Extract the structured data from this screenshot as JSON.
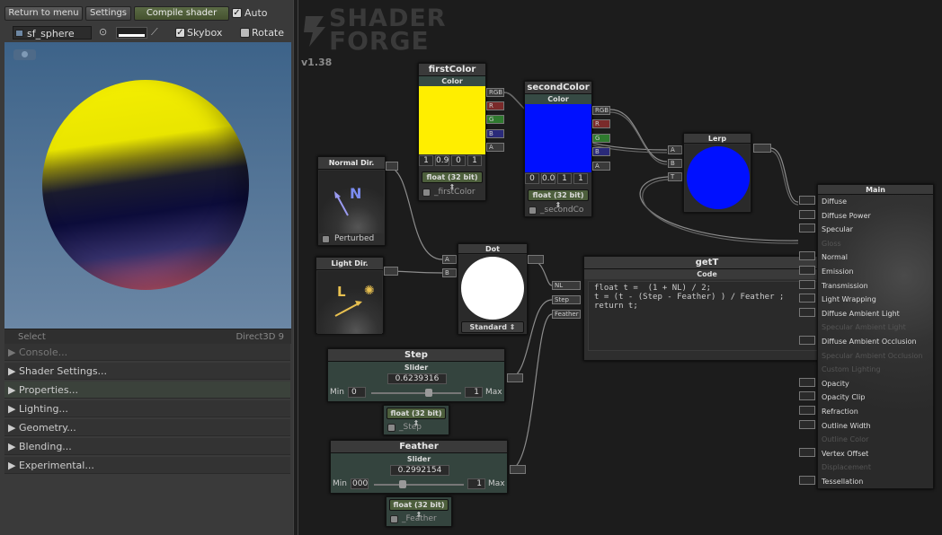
{
  "toolbar": {
    "return_label": "Return to menu",
    "settings_label": "Settings",
    "compile_label": "Compile shader",
    "auto_label": "Auto",
    "mesh_name": "sf_sphere",
    "skybox_label": "Skybox",
    "rotate_label": "Rotate"
  },
  "preview": {
    "select_label": "Select",
    "renderer": "Direct3D 9"
  },
  "sections": [
    "Console...",
    "Shader Settings...",
    "Properties...",
    "Lighting...",
    "Geometry...",
    "Blending...",
    "Experimental..."
  ],
  "logo": {
    "line1": "SHADER",
    "line2": "FORGE",
    "version": "v1.38"
  },
  "nodes": {
    "firstColor": {
      "title": "firstColor",
      "sub": "Color",
      "color": "#ffee00",
      "values": [
        "1",
        "0.9",
        "0",
        "1"
      ],
      "prec": "float (32 bit)",
      "var": "_firstColor",
      "ports": [
        "RGB",
        "R",
        "G",
        "B",
        "A"
      ]
    },
    "secondColor": {
      "title": "secondColor",
      "sub": "Color",
      "color": "#0010ff",
      "values": [
        "0",
        "0.0",
        "1",
        "1"
      ],
      "prec": "float (32 bit)",
      "var": "_secondCo",
      "ports": [
        "RGB",
        "R",
        "G",
        "B",
        "A"
      ]
    },
    "lerp": {
      "title": "Lerp",
      "ports": [
        "A",
        "B",
        "T"
      ]
    },
    "normalDir": {
      "title": "Normal Dir.",
      "glyph": "N",
      "opt": "Perturbed"
    },
    "lightDir": {
      "title": "Light Dir.",
      "glyph": "L"
    },
    "dot": {
      "title": "Dot",
      "ports": [
        "A",
        "B"
      ],
      "mode": "Standard"
    },
    "getT": {
      "title": "getT",
      "sub": "Code",
      "code": "float t =  (1 + NL) / 2;\nt = (t - (Step - Feather) ) / Feather ;\nreturn t;",
      "inputs": [
        "NL",
        "Step",
        "Feather"
      ]
    },
    "step": {
      "title": "Step",
      "sub": "Slider",
      "value": "0.6239316",
      "min_label": "Min",
      "min": "0",
      "max": "1",
      "max_label": "Max",
      "slider_fraction": 0.62,
      "prec": "float (32 bit)",
      "var": "_Step"
    },
    "feather": {
      "title": "Feather",
      "sub": "Slider",
      "value": "0.2992154",
      "min_label": "Min",
      "min": "000",
      "max": "1",
      "max_label": "Max",
      "slider_fraction": 0.3,
      "prec": "float (32 bit)",
      "var": "_Feather"
    },
    "main": {
      "title": "Main",
      "inputs": [
        {
          "label": "Diffuse",
          "enabled": true
        },
        {
          "label": "Diffuse Power",
          "enabled": true
        },
        {
          "label": "Specular",
          "enabled": true
        },
        {
          "label": "Gloss",
          "enabled": false
        },
        {
          "label": "Normal",
          "enabled": true
        },
        {
          "label": "Emission",
          "enabled": true
        },
        {
          "label": "Transmission",
          "enabled": true
        },
        {
          "label": "Light Wrapping",
          "enabled": true
        },
        {
          "label": "Diffuse Ambient Light",
          "enabled": true
        },
        {
          "label": "Specular Ambient Light",
          "enabled": false
        },
        {
          "label": "Diffuse Ambient Occlusion",
          "enabled": true
        },
        {
          "label": "Specular Ambient Occlusion",
          "enabled": false
        },
        {
          "label": "Custom Lighting",
          "enabled": false
        },
        {
          "label": "Opacity",
          "enabled": true
        },
        {
          "label": "Opacity Clip",
          "enabled": true
        },
        {
          "label": "Refraction",
          "enabled": true
        },
        {
          "label": "Outline Width",
          "enabled": true
        },
        {
          "label": "Outline Color",
          "enabled": false
        },
        {
          "label": "Vertex Offset",
          "enabled": true
        },
        {
          "label": "Displacement",
          "enabled": false
        },
        {
          "label": "Tessellation",
          "enabled": true
        }
      ]
    }
  },
  "colors": {
    "accent_green": "#4d5f3c",
    "port_red": "#7a2a2a",
    "port_green": "#2f7a2f",
    "port_blue": "#2a2a7a"
  }
}
